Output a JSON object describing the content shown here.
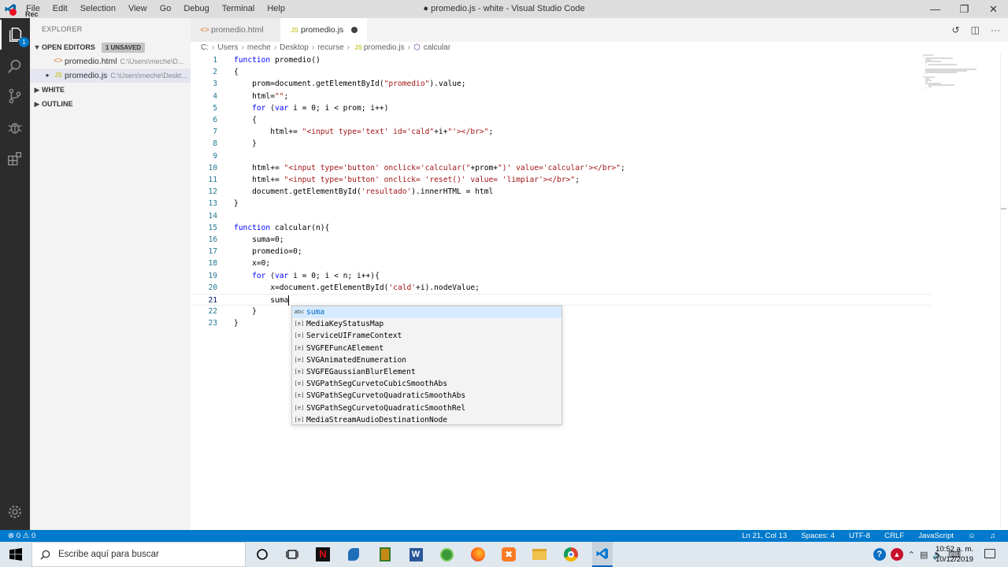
{
  "window": {
    "title": "● promedio.js - white - Visual Studio Code",
    "menu": [
      "File",
      "Edit",
      "Selection",
      "View",
      "Go",
      "Debug",
      "Terminal",
      "Help"
    ],
    "rec_label": "Rec"
  },
  "activity": {
    "explorer_badge": "1"
  },
  "sidebar": {
    "header": "EXPLORER",
    "open_editors": "OPEN EDITORS",
    "unsaved": "1 UNSAVED",
    "files": [
      {
        "name": "promedio.html",
        "path": "C:\\Users\\meche\\D..."
      },
      {
        "name": "promedio.js",
        "path": "C:\\Users\\meche\\Deskt..."
      }
    ],
    "white": "WHITE",
    "outline": "OUTLINE"
  },
  "tabs": [
    {
      "label": "promedio.html",
      "active": false
    },
    {
      "label": "promedio.js",
      "active": true
    }
  ],
  "breadcrumb": [
    "C:",
    "Users",
    "meche",
    "Desktop",
    "recurse",
    "promedio.js",
    "calcular"
  ],
  "editor": {
    "lines": [
      "function promedio()",
      "{",
      "    prom=document.getElementById(\"promedio\").value;",
      "    html=\"\";",
      "    for (var i = 0; i < prom; i++)",
      "    {",
      "        html+= \"<input type='text' id='cald\"+i+\"'></br>\";",
      "    }",
      "",
      "    html+= \"<input type='button' onclick='calcular(\"+prom+\")' value='calcular'></br>\";",
      "    html+= \"<input type='button' onclick= 'reset()' value= 'limpiar'></br>\";",
      "    document.getElementById('resultado').innerHTML = html",
      "}",
      "",
      "function calcular(n){",
      "    suma=0;",
      "    promedio=0;",
      "    x=0;",
      "    for (var i = 0; i < n; i++){",
      "        x=document.getElementById('cald'+i).nodeValue;",
      "        suma",
      "    }",
      "}"
    ],
    "current_line": 21
  },
  "suggestions": [
    {
      "icon": "abc",
      "label": "suma"
    },
    {
      "icon": "[e]",
      "label": "MediaKeyStatusMap"
    },
    {
      "icon": "[e]",
      "label": "ServiceUIFrameContext"
    },
    {
      "icon": "[e]",
      "label": "SVGFEFuncAElement"
    },
    {
      "icon": "[e]",
      "label": "SVGAnimatedEnumeration"
    },
    {
      "icon": "[e]",
      "label": "SVGFEGaussianBlurElement"
    },
    {
      "icon": "[e]",
      "label": "SVGPathSegCurvetoCubicSmoothAbs"
    },
    {
      "icon": "[e]",
      "label": "SVGPathSegCurvetoQuadraticSmoothAbs"
    },
    {
      "icon": "[e]",
      "label": "SVGPathSegCurvetoQuadraticSmoothRel"
    },
    {
      "icon": "[e]",
      "label": "MediaStreamAudioDestinationNode"
    }
  ],
  "status": {
    "problems": "⊗ 0 ⚠ 0",
    "position": "Ln 21, Col 13",
    "spaces": "Spaces: 4",
    "encoding": "UTF-8",
    "eol": "CRLF",
    "language": "JavaScript"
  },
  "taskbar": {
    "search_placeholder": "Escribe aquí para buscar",
    "time": "10:52 a. m.",
    "date": "10/12/2019"
  },
  "colors": {
    "activity_bar": "#2c2c2c",
    "status_bar": "#007acc",
    "sidebar": "#f3f3f3",
    "keyword": "#0000ff",
    "string": "#a31515"
  }
}
